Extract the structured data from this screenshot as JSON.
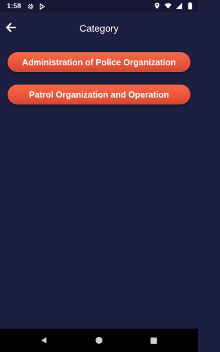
{
  "status_bar": {
    "time": "1:58",
    "left_icons": [
      "gear-icon",
      "play-store-icon"
    ],
    "right_icons": [
      "location-icon",
      "wifi-icon",
      "signal-icon",
      "battery-icon"
    ]
  },
  "app_bar": {
    "title": "Category",
    "back_icon": "arrow-left-icon"
  },
  "categories": [
    {
      "label": "Administration of Police Organization"
    },
    {
      "label": "Patrol Organization and Operation"
    }
  ],
  "nav_bar": {
    "icons": [
      "back-triangle-icon",
      "home-circle-icon",
      "recents-square-icon"
    ]
  },
  "colors": {
    "background": "#1d1f40",
    "status_bar": "#151734",
    "button": "#e9543a",
    "button_text": "#ffffff",
    "nav_bar": "#000000"
  }
}
